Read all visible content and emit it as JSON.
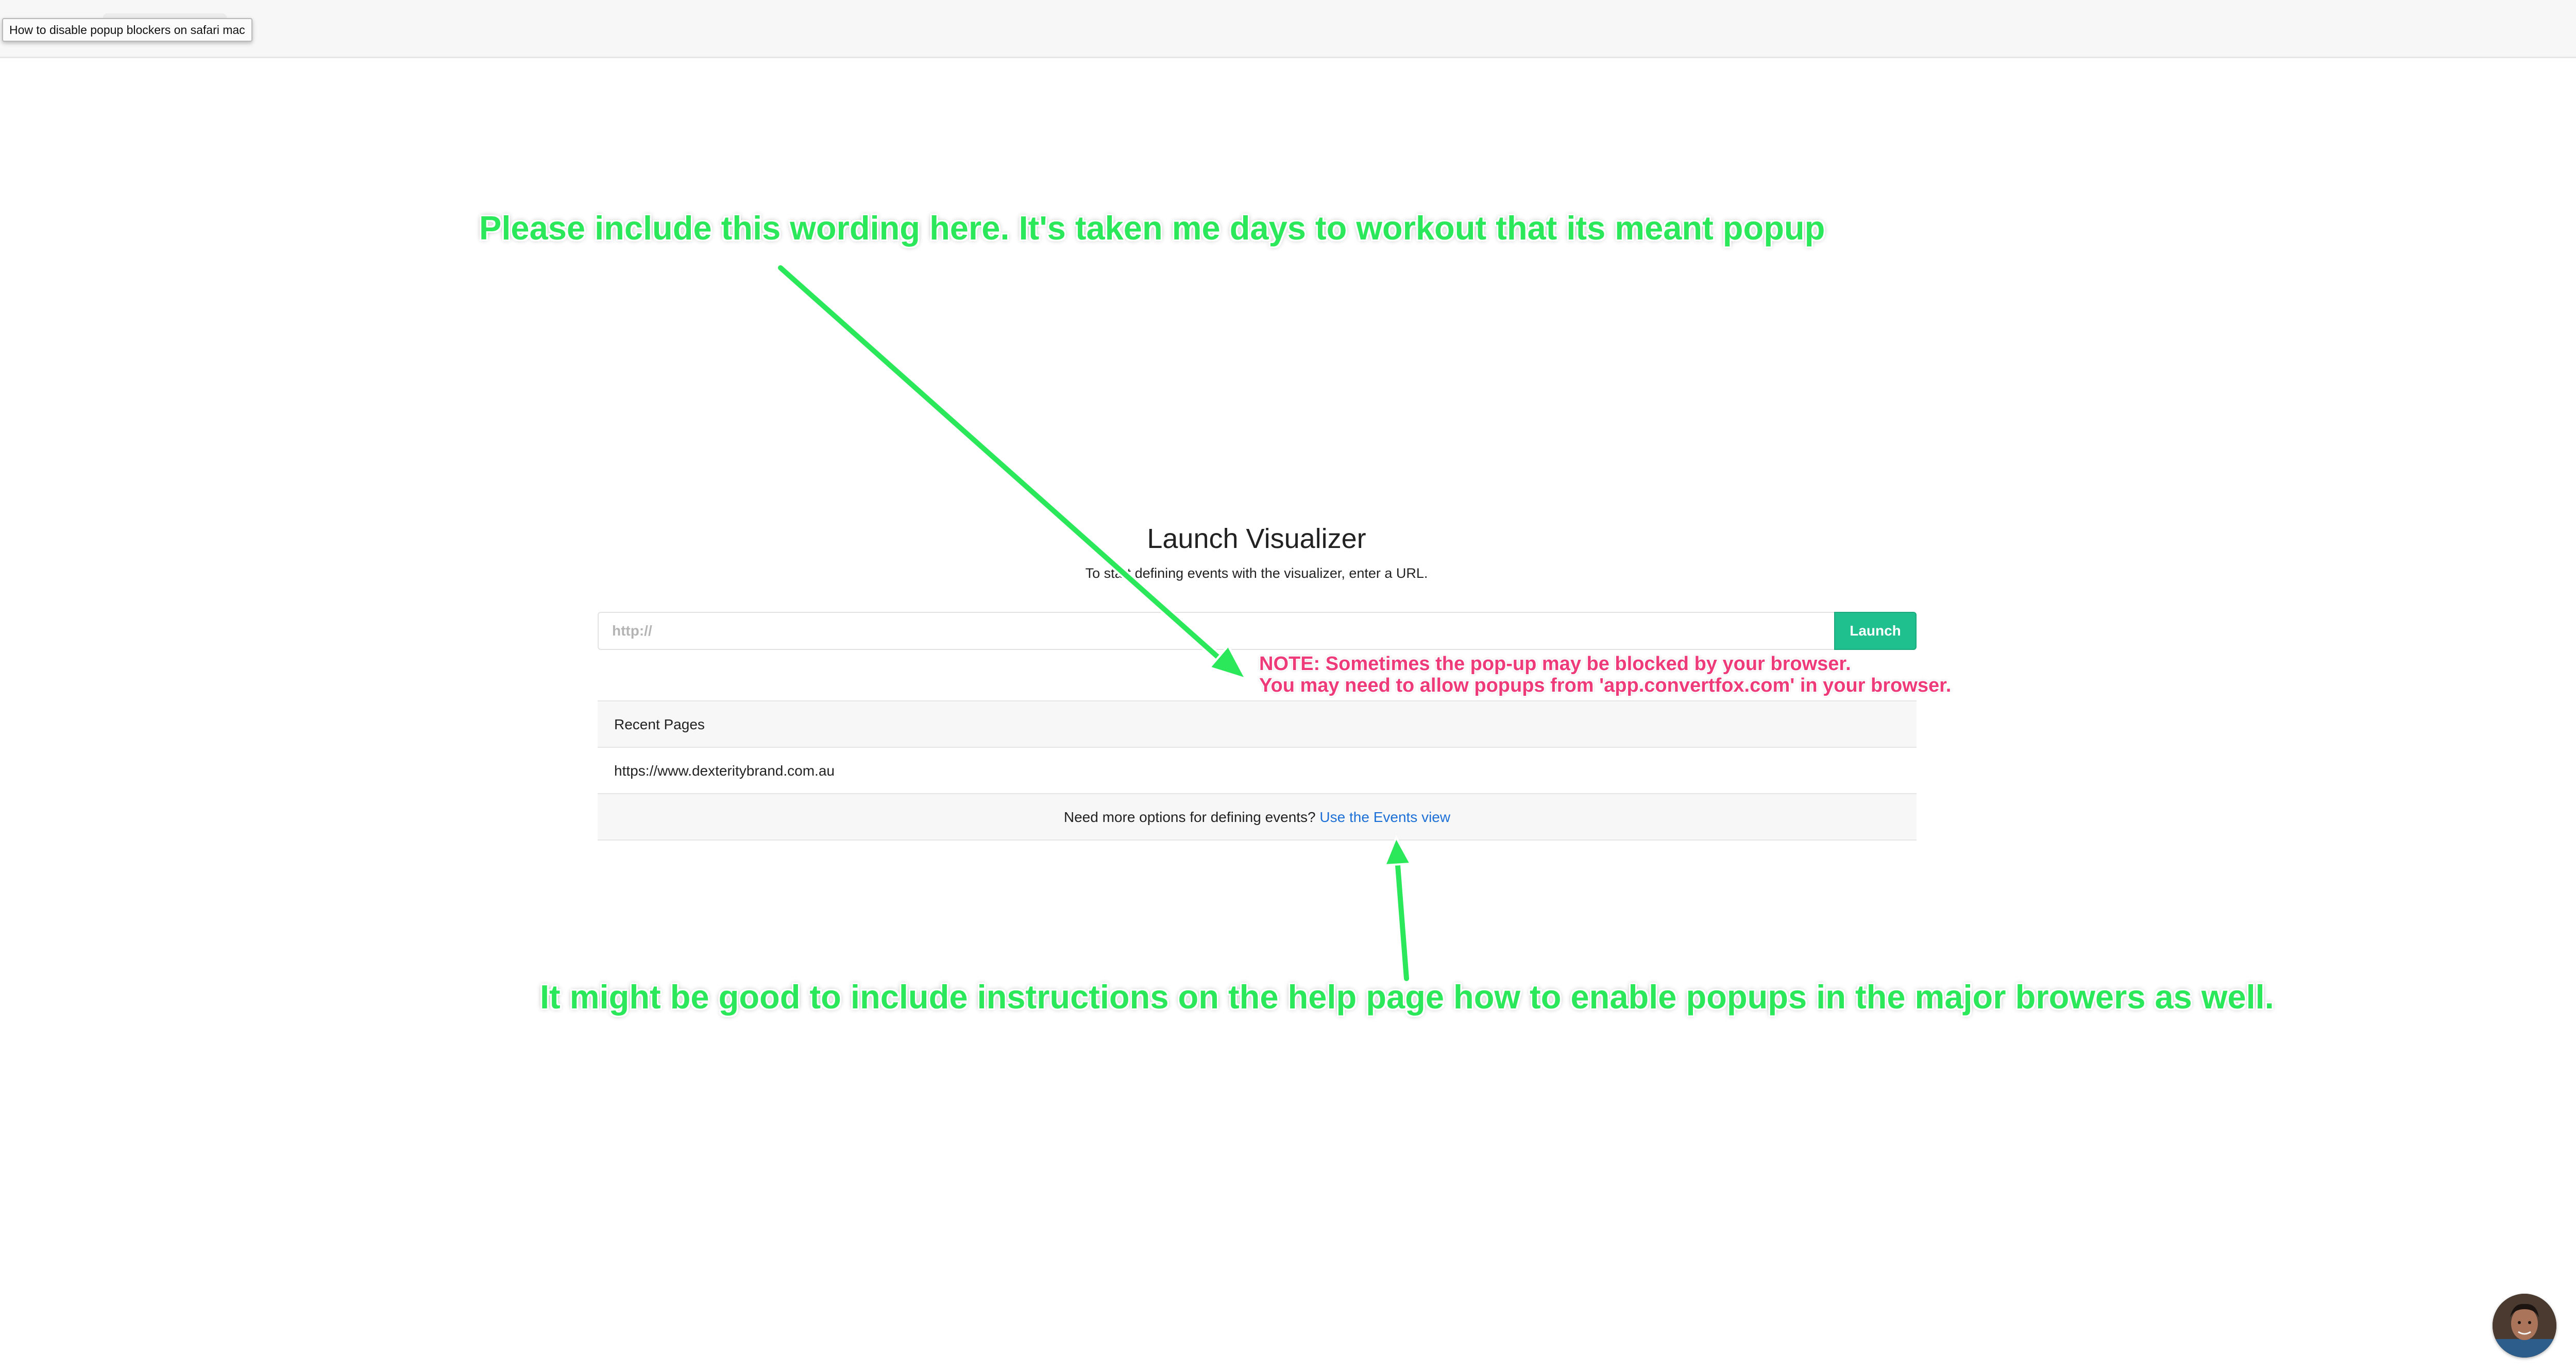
{
  "tooltip": {
    "text": "How to disable popup blockers on safari mac"
  },
  "annotations": {
    "top": "Please include this wording here. It's taken me days to workout that its meant popup",
    "bottom": "It might be good to include instructions on the help page how to enable popups in the major browers as well.",
    "note_line1": "NOTE: Sometimes the pop-up may be blocked by your browser.",
    "note_line2": "You may need to allow popups from 'app.convertfox.com' in your browser."
  },
  "main": {
    "title": "Launch Visualizer",
    "subtitle": "To start defining events with the visualizer, enter a URL.",
    "url_input": {
      "value": "",
      "placeholder": "http://"
    },
    "launch_label": "Launch"
  },
  "recent": {
    "header": "Recent Pages",
    "items": [
      "https://www.dexteritybrand.com.au"
    ]
  },
  "footer": {
    "text": "Need more options for defining events?",
    "link_label": "Use the Events view"
  },
  "colors": {
    "annotation_green": "#2be85a",
    "note_pink": "#ef3a7a",
    "launch_button": "#1fbf8e",
    "link_blue": "#1b6fd6"
  }
}
